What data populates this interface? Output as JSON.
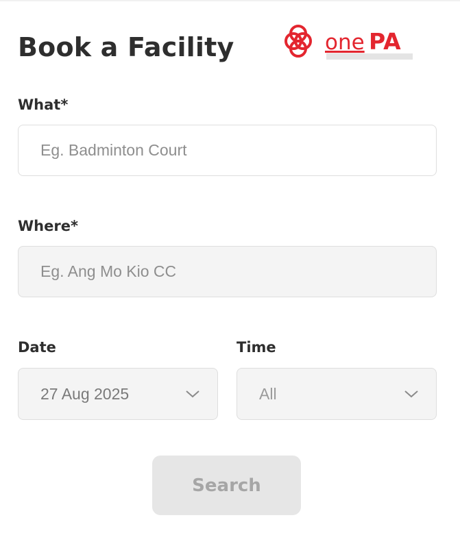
{
  "header": {
    "title": "Book a Facility",
    "logo": {
      "text_one": "one",
      "text_pa": "PA",
      "brand_color": "#e3262f",
      "icon": "onepa-logo-icon"
    }
  },
  "form": {
    "what": {
      "label": "What*",
      "placeholder": "Eg. Badminton Court",
      "value": ""
    },
    "where": {
      "label": "Where*",
      "placeholder": "Eg. Ang Mo Kio CC",
      "value": ""
    },
    "date": {
      "label": "Date",
      "value": "27 Aug 2025",
      "icon": "chevron-down-icon"
    },
    "time": {
      "label": "Time",
      "value": "All",
      "icon": "chevron-down-icon"
    },
    "search_label": "Search"
  },
  "colors": {
    "accent": "#e3262f",
    "title": "#2e2e2e",
    "button_disabled_bg": "#e6e6e6",
    "button_disabled_text": "#a6a6a6"
  }
}
